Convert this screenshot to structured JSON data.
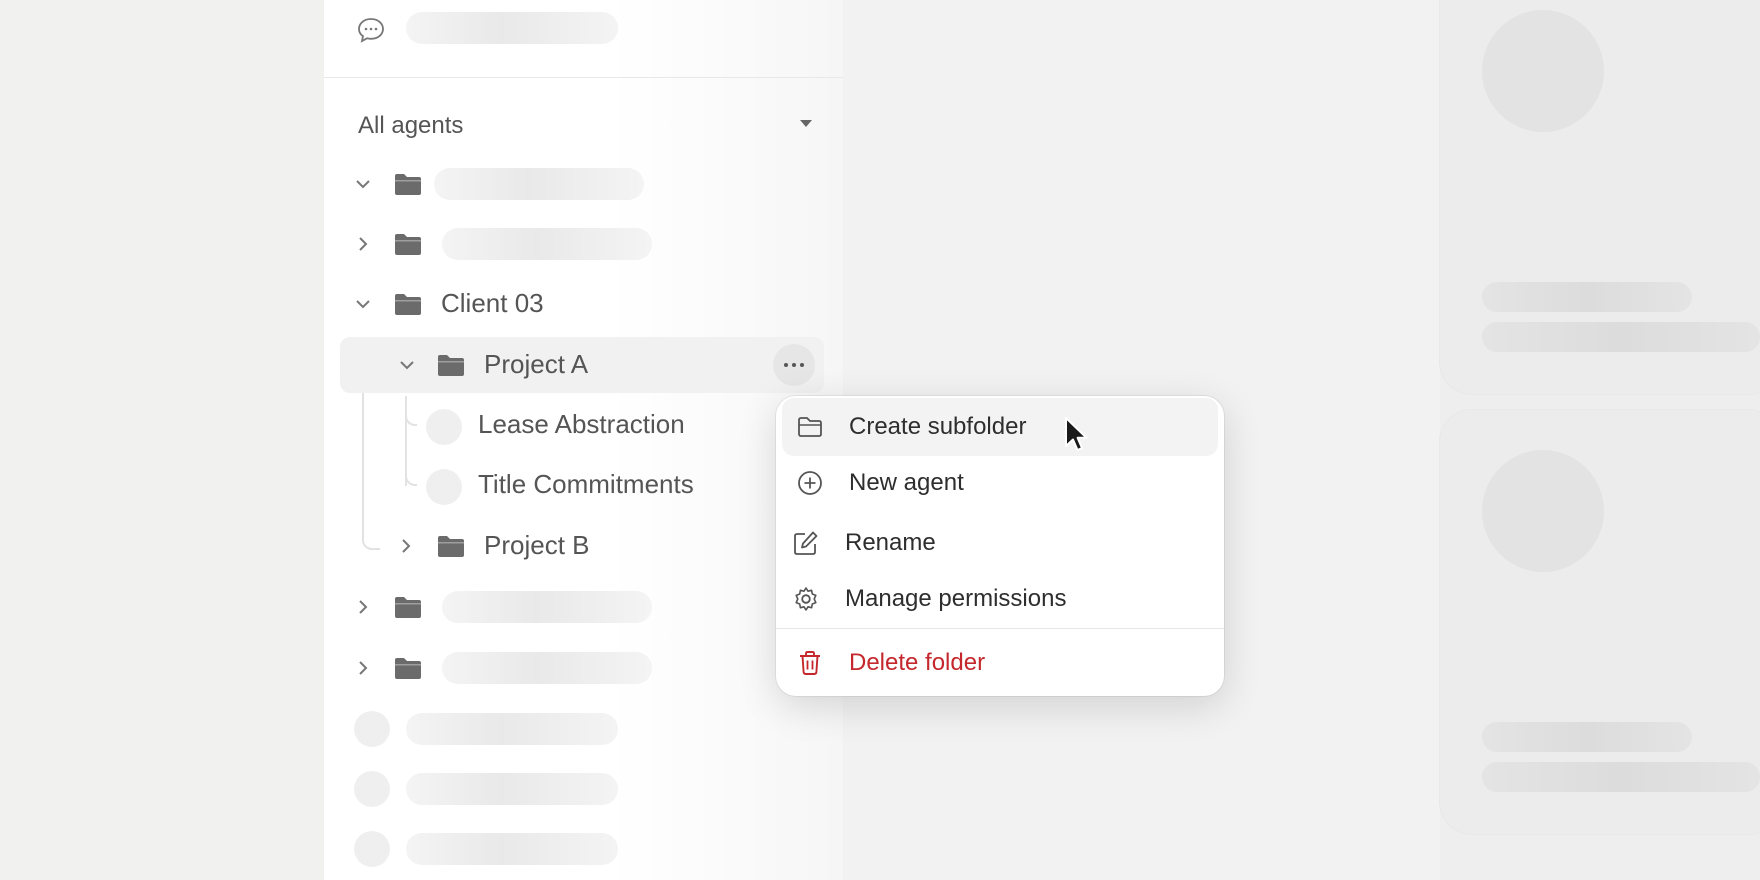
{
  "sidebar": {
    "filter": {
      "label": "All agents"
    },
    "tree": {
      "client": {
        "label": "Client 03"
      },
      "project_a": {
        "label": "Project A"
      },
      "agents": [
        {
          "label": "Lease Abstraction"
        },
        {
          "label": "Title Commitments"
        }
      ],
      "project_b": {
        "label": "Project B"
      }
    }
  },
  "context_menu": {
    "items": [
      {
        "label": "Create subfolder",
        "icon": "folder-outline-icon"
      },
      {
        "label": "New agent",
        "icon": "plus-circle-icon"
      },
      {
        "label": "Rename",
        "icon": "edit-icon"
      },
      {
        "label": "Manage permissions",
        "icon": "gear-icon"
      },
      {
        "label": "Delete folder",
        "icon": "trash-icon",
        "color": "#c5282c"
      }
    ]
  },
  "colors": {
    "danger": "#c5282c",
    "highlight": "#f1f1f1",
    "folder": "#6b6b6b"
  }
}
